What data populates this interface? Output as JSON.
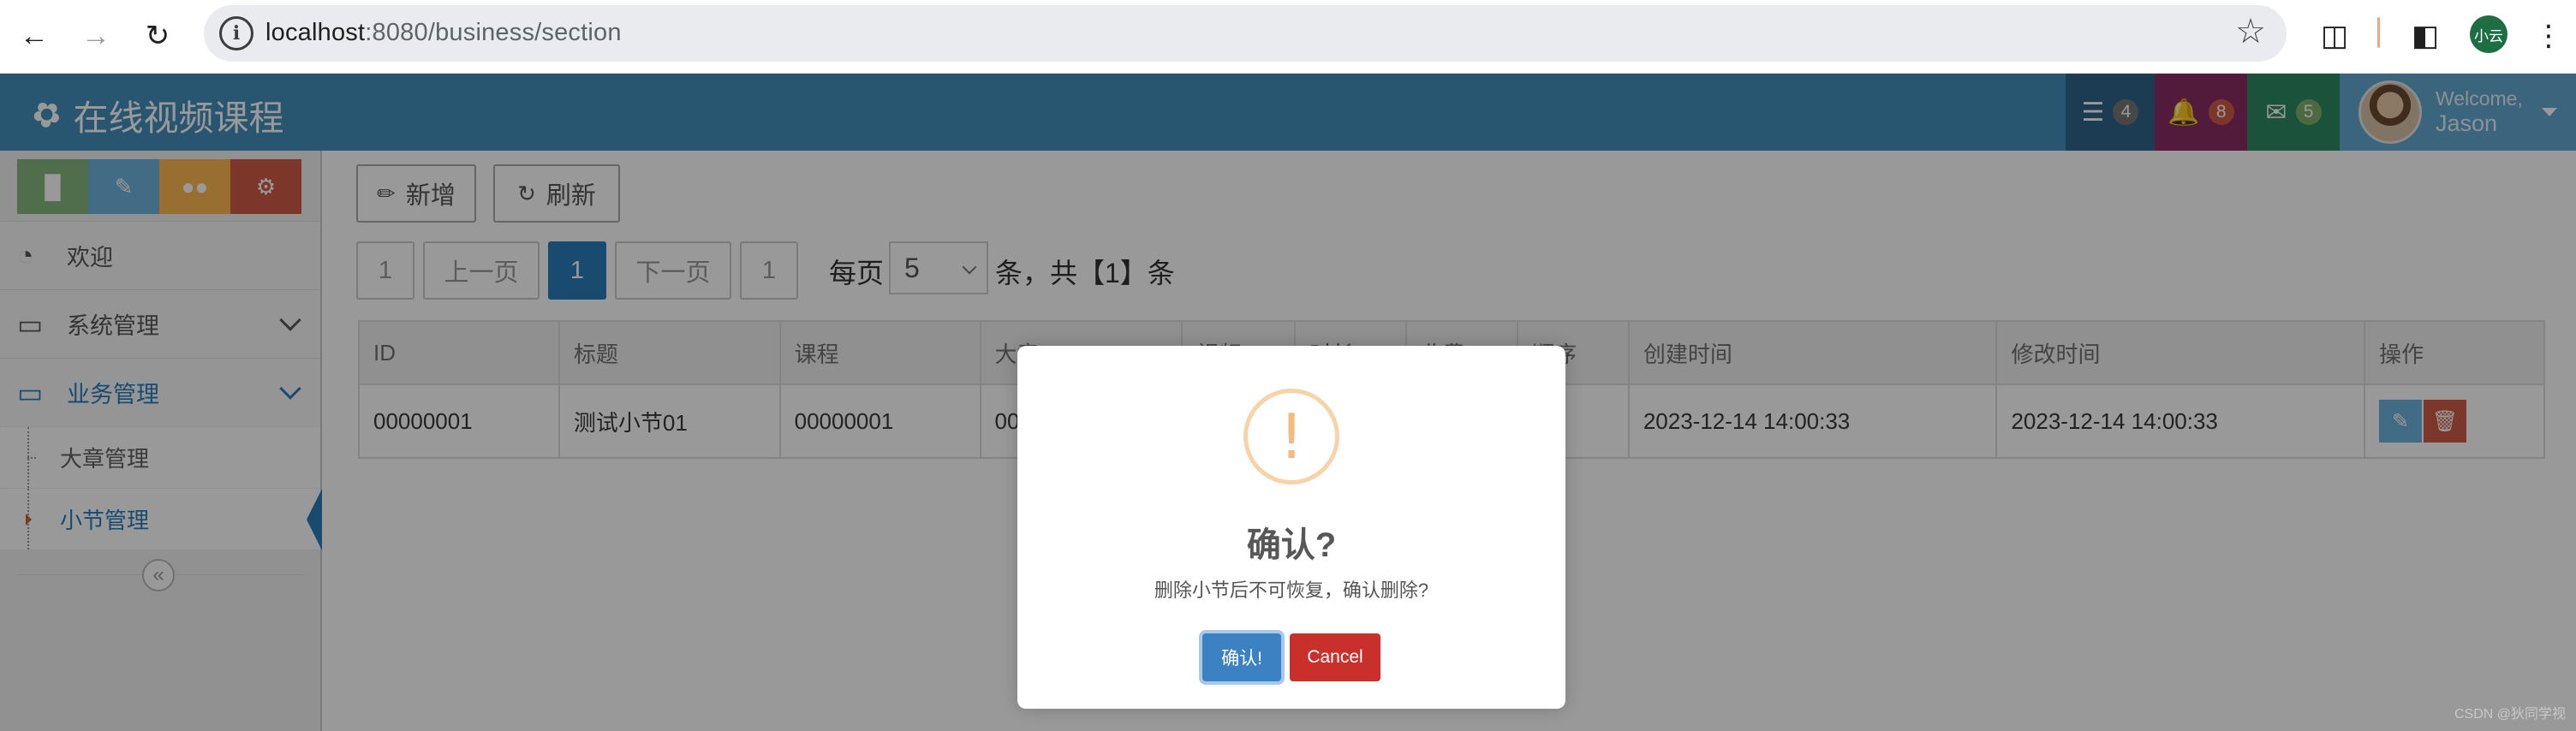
{
  "browser": {
    "url_host": "localhost",
    "url_rest": ":8080/business/section",
    "profile_label": "小云"
  },
  "navbar": {
    "brand": "在线视频课程",
    "tiles": [
      {
        "badge": "4",
        "color": "#2e6589",
        "badge_color": "#777777"
      },
      {
        "badge": "8",
        "color": "#892e65",
        "badge_color": "#d15b47"
      },
      {
        "badge": "5",
        "color": "#2e8965",
        "badge_color": "#82af6f"
      }
    ],
    "welcome_line1": "Welcome,",
    "welcome_line2": "Jason"
  },
  "sidebar": {
    "shortcuts": [
      {
        "icon": "signal-icon",
        "color": "#87b87f"
      },
      {
        "icon": "pencil-icon",
        "color": "#6fb3e0"
      },
      {
        "icon": "users-icon",
        "color": "#ffb752"
      },
      {
        "icon": "cogs-icon",
        "color": "#d15b47"
      }
    ],
    "items": [
      {
        "label": "欢迎",
        "icon": "dashboard-icon"
      },
      {
        "label": "系统管理",
        "icon": "desktop-icon"
      },
      {
        "label": "业务管理",
        "icon": "desktop-icon"
      }
    ],
    "subitems": [
      {
        "label": "大章管理"
      },
      {
        "label": "小节管理"
      }
    ]
  },
  "toolbar": {
    "add_label": "新增",
    "refresh_label": "刷新"
  },
  "pagination": {
    "first": "1",
    "prev": "上一页",
    "current": "1",
    "next": "下一页",
    "last": "1",
    "per_page_label": "每页",
    "per_page_value": "5",
    "total_label": "条，共【1】条"
  },
  "table": {
    "headers": [
      "ID",
      "标题",
      "课程",
      "大章",
      "视频",
      "时长",
      "收费",
      "顺序",
      "创建时间",
      "修改时间",
      "操作"
    ],
    "rows": [
      [
        "00000001",
        "测试小节01",
        "00000001",
        "00",
        "",
        "",
        "",
        "",
        "2023-12-14 14:00:33",
        "2023-12-14 14:00:33"
      ]
    ]
  },
  "modal": {
    "icon": "!",
    "title": "确认?",
    "text": "删除小节后不可恢复，确认删除?",
    "confirm_label": "确认!",
    "cancel_label": "Cancel"
  },
  "watermark": "CSDN @狄同学视"
}
